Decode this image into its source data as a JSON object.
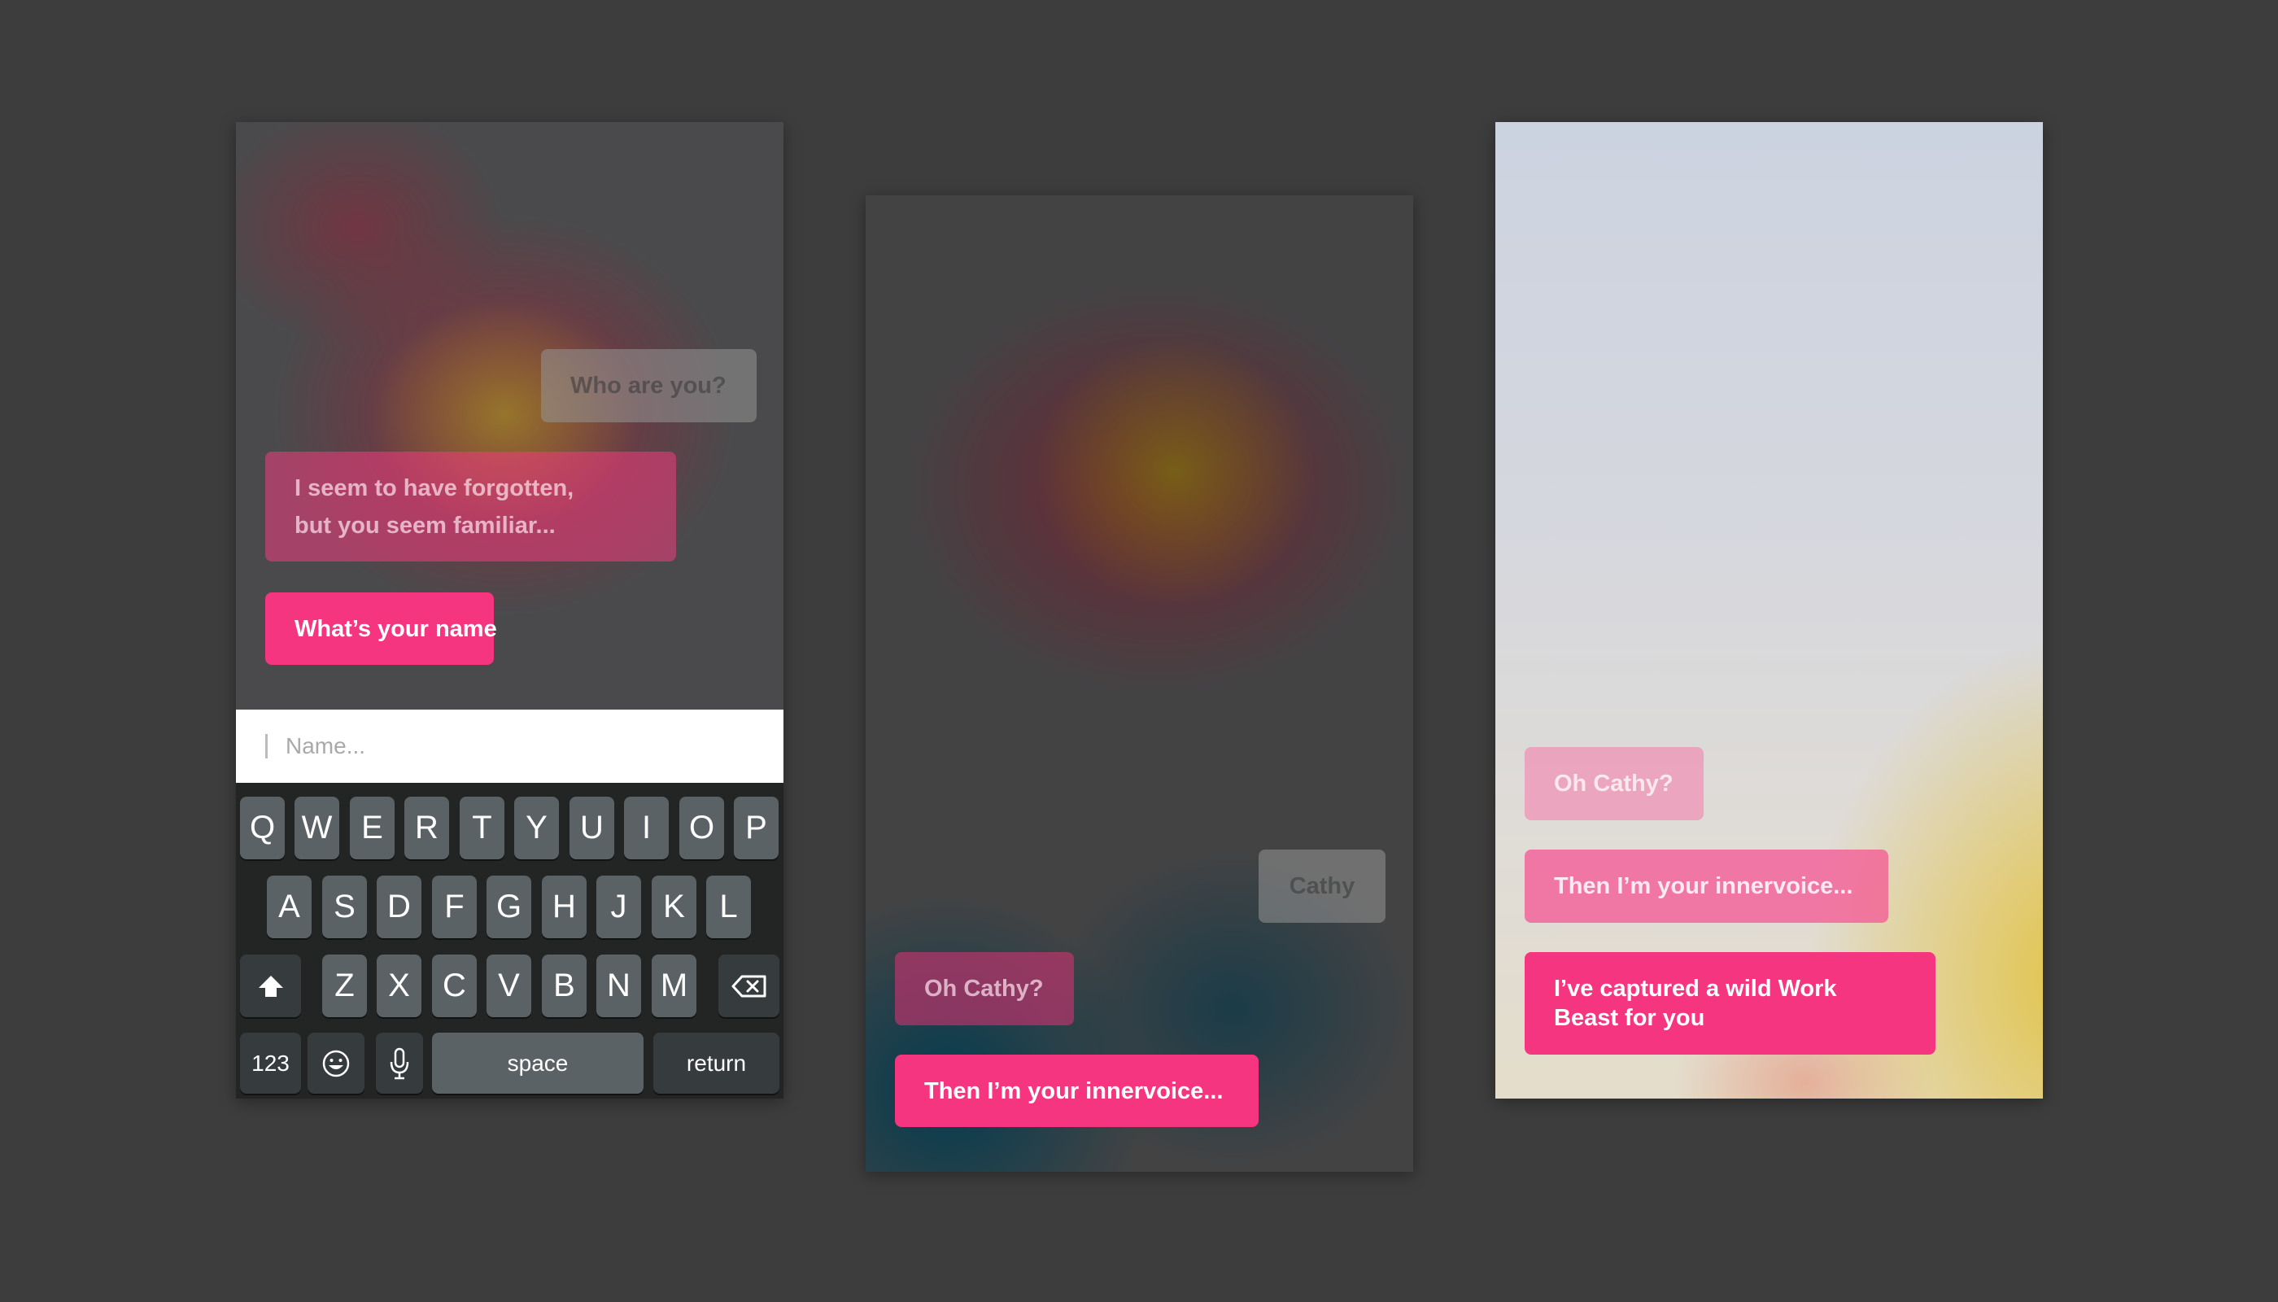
{
  "screen1": {
    "messages": {
      "who_are_you": "Who are you?",
      "forgotten_line1": "I seem to have forgotten,",
      "forgotten_line2": "but you seem familiar...",
      "whats_your_name": "What’s your name"
    },
    "name_input": {
      "placeholder": "Name..."
    },
    "keyboard": {
      "row1": [
        "Q",
        "W",
        "E",
        "R",
        "T",
        "Y",
        "U",
        "I",
        "O",
        "P"
      ],
      "row2": [
        "A",
        "S",
        "D",
        "F",
        "G",
        "H",
        "J",
        "K",
        "L"
      ],
      "row3": [
        "Z",
        "X",
        "C",
        "V",
        "B",
        "N",
        "M"
      ],
      "numbers_key": "123",
      "space_key": "space",
      "return_key": "return",
      "shift_icon": "shift-arrow-icon",
      "delete_icon": "backspace-icon",
      "emoji_icon": "emoji-icon",
      "mic_icon": "microphone-icon"
    }
  },
  "screen2": {
    "messages": {
      "cathy": "Cathy",
      "oh_cathy": "Oh Cathy?",
      "innervoice": "Then I’m your innervoice..."
    }
  },
  "screen3": {
    "messages": {
      "oh_cathy": "Oh Cathy?",
      "innervoice": "Then I’m your innervoice...",
      "work_beast": "I’ve captured a wild Work Beast for you"
    }
  },
  "colors": {
    "page_background": "#3d3d3d",
    "accent_pink": "#f5357f",
    "keyboard_background": "#232525",
    "key_color": "#5a6266"
  }
}
